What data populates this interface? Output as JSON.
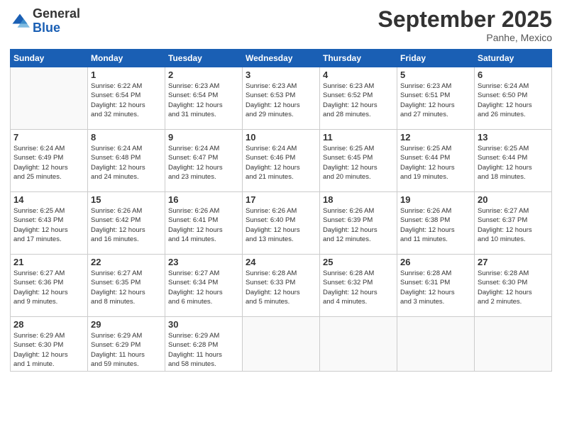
{
  "logo": {
    "general": "General",
    "blue": "Blue"
  },
  "header": {
    "month": "September 2025",
    "location": "Panhe, Mexico"
  },
  "weekdays": [
    "Sunday",
    "Monday",
    "Tuesday",
    "Wednesday",
    "Thursday",
    "Friday",
    "Saturday"
  ],
  "weeks": [
    [
      {
        "day": "",
        "info": ""
      },
      {
        "day": "1",
        "info": "Sunrise: 6:22 AM\nSunset: 6:54 PM\nDaylight: 12 hours\nand 32 minutes."
      },
      {
        "day": "2",
        "info": "Sunrise: 6:23 AM\nSunset: 6:54 PM\nDaylight: 12 hours\nand 31 minutes."
      },
      {
        "day": "3",
        "info": "Sunrise: 6:23 AM\nSunset: 6:53 PM\nDaylight: 12 hours\nand 29 minutes."
      },
      {
        "day": "4",
        "info": "Sunrise: 6:23 AM\nSunset: 6:52 PM\nDaylight: 12 hours\nand 28 minutes."
      },
      {
        "day": "5",
        "info": "Sunrise: 6:23 AM\nSunset: 6:51 PM\nDaylight: 12 hours\nand 27 minutes."
      },
      {
        "day": "6",
        "info": "Sunrise: 6:24 AM\nSunset: 6:50 PM\nDaylight: 12 hours\nand 26 minutes."
      }
    ],
    [
      {
        "day": "7",
        "info": "Sunrise: 6:24 AM\nSunset: 6:49 PM\nDaylight: 12 hours\nand 25 minutes."
      },
      {
        "day": "8",
        "info": "Sunrise: 6:24 AM\nSunset: 6:48 PM\nDaylight: 12 hours\nand 24 minutes."
      },
      {
        "day": "9",
        "info": "Sunrise: 6:24 AM\nSunset: 6:47 PM\nDaylight: 12 hours\nand 23 minutes."
      },
      {
        "day": "10",
        "info": "Sunrise: 6:24 AM\nSunset: 6:46 PM\nDaylight: 12 hours\nand 21 minutes."
      },
      {
        "day": "11",
        "info": "Sunrise: 6:25 AM\nSunset: 6:45 PM\nDaylight: 12 hours\nand 20 minutes."
      },
      {
        "day": "12",
        "info": "Sunrise: 6:25 AM\nSunset: 6:44 PM\nDaylight: 12 hours\nand 19 minutes."
      },
      {
        "day": "13",
        "info": "Sunrise: 6:25 AM\nSunset: 6:44 PM\nDaylight: 12 hours\nand 18 minutes."
      }
    ],
    [
      {
        "day": "14",
        "info": "Sunrise: 6:25 AM\nSunset: 6:43 PM\nDaylight: 12 hours\nand 17 minutes."
      },
      {
        "day": "15",
        "info": "Sunrise: 6:26 AM\nSunset: 6:42 PM\nDaylight: 12 hours\nand 16 minutes."
      },
      {
        "day": "16",
        "info": "Sunrise: 6:26 AM\nSunset: 6:41 PM\nDaylight: 12 hours\nand 14 minutes."
      },
      {
        "day": "17",
        "info": "Sunrise: 6:26 AM\nSunset: 6:40 PM\nDaylight: 12 hours\nand 13 minutes."
      },
      {
        "day": "18",
        "info": "Sunrise: 6:26 AM\nSunset: 6:39 PM\nDaylight: 12 hours\nand 12 minutes."
      },
      {
        "day": "19",
        "info": "Sunrise: 6:26 AM\nSunset: 6:38 PM\nDaylight: 12 hours\nand 11 minutes."
      },
      {
        "day": "20",
        "info": "Sunrise: 6:27 AM\nSunset: 6:37 PM\nDaylight: 12 hours\nand 10 minutes."
      }
    ],
    [
      {
        "day": "21",
        "info": "Sunrise: 6:27 AM\nSunset: 6:36 PM\nDaylight: 12 hours\nand 9 minutes."
      },
      {
        "day": "22",
        "info": "Sunrise: 6:27 AM\nSunset: 6:35 PM\nDaylight: 12 hours\nand 8 minutes."
      },
      {
        "day": "23",
        "info": "Sunrise: 6:27 AM\nSunset: 6:34 PM\nDaylight: 12 hours\nand 6 minutes."
      },
      {
        "day": "24",
        "info": "Sunrise: 6:28 AM\nSunset: 6:33 PM\nDaylight: 12 hours\nand 5 minutes."
      },
      {
        "day": "25",
        "info": "Sunrise: 6:28 AM\nSunset: 6:32 PM\nDaylight: 12 hours\nand 4 minutes."
      },
      {
        "day": "26",
        "info": "Sunrise: 6:28 AM\nSunset: 6:31 PM\nDaylight: 12 hours\nand 3 minutes."
      },
      {
        "day": "27",
        "info": "Sunrise: 6:28 AM\nSunset: 6:30 PM\nDaylight: 12 hours\nand 2 minutes."
      }
    ],
    [
      {
        "day": "28",
        "info": "Sunrise: 6:29 AM\nSunset: 6:30 PM\nDaylight: 12 hours\nand 1 minute."
      },
      {
        "day": "29",
        "info": "Sunrise: 6:29 AM\nSunset: 6:29 PM\nDaylight: 11 hours\nand 59 minutes."
      },
      {
        "day": "30",
        "info": "Sunrise: 6:29 AM\nSunset: 6:28 PM\nDaylight: 11 hours\nand 58 minutes."
      },
      {
        "day": "",
        "info": ""
      },
      {
        "day": "",
        "info": ""
      },
      {
        "day": "",
        "info": ""
      },
      {
        "day": "",
        "info": ""
      }
    ]
  ]
}
